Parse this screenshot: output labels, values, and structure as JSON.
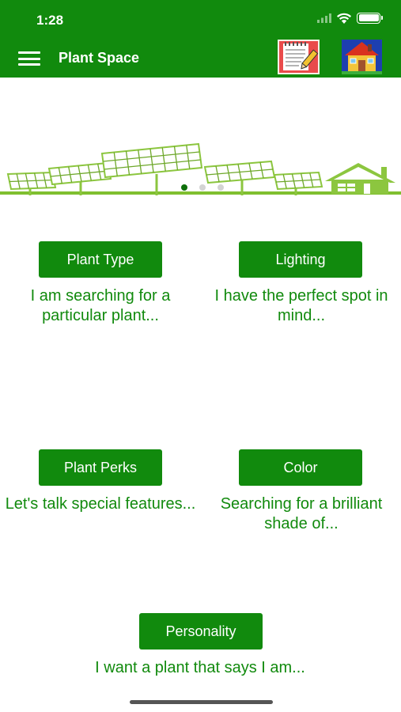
{
  "status_bar": {
    "time": "1:28"
  },
  "app_bar": {
    "title": "Plant Space",
    "menu_icon": "hamburger-menu-icon",
    "actions": [
      "notepad-icon",
      "house-icon"
    ]
  },
  "carousel": {
    "page_count": 3,
    "active_index": 0
  },
  "categories": [
    {
      "label": "Plant Type",
      "description": "I am searching for a particular plant..."
    },
    {
      "label": "Lighting",
      "description": "I have the perfect spot in mind..."
    },
    {
      "label": "Plant Perks",
      "description": "Let's talk special features..."
    },
    {
      "label": "Color",
      "description": "Searching for a brilliant shade of..."
    },
    {
      "label": "Personality",
      "description": "I want a plant that says I am..."
    }
  ],
  "colors": {
    "primary": "#118a0d",
    "panel": "#8cc63f",
    "panel_stroke": "#6ea82a",
    "background": "#ffffff"
  }
}
